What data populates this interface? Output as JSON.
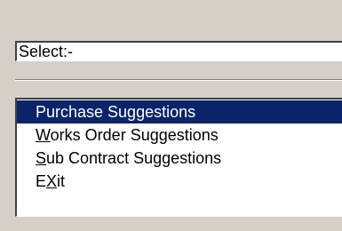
{
  "select_field": {
    "text": "Select:-"
  },
  "menu": {
    "items": [
      {
        "label": "Purchase Suggestions",
        "selected": true,
        "mnemonic_index": null
      },
      {
        "label": "Works Order Suggestions",
        "selected": false,
        "mnemonic_index": 0
      },
      {
        "label": "Sub Contract Suggestions",
        "selected": false,
        "mnemonic_index": 0
      },
      {
        "label": "EXit",
        "selected": false,
        "mnemonic_index": 1
      }
    ]
  },
  "colors": {
    "window_bg": "#d4d0c8",
    "selection_bg": "#0a246a",
    "selection_text": "#ffffff"
  }
}
